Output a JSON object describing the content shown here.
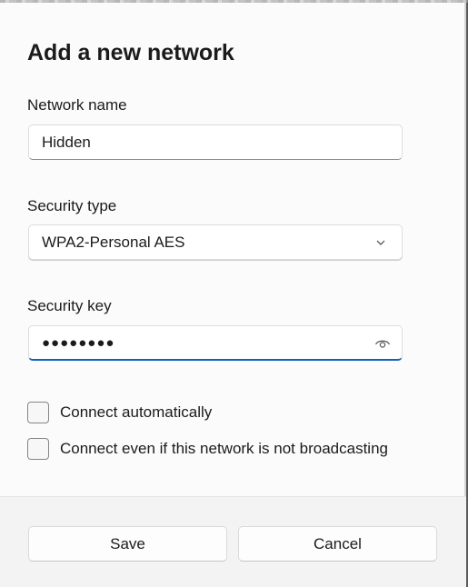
{
  "dialog": {
    "title": "Add a new network",
    "network_name": {
      "label": "Network name",
      "value": "Hidden"
    },
    "security_type": {
      "label": "Security type",
      "value": "WPA2-Personal AES",
      "icon": "chevron-down-icon"
    },
    "security_key": {
      "label": "Security key",
      "value": "●●●●●●●●",
      "icon": "reveal-password-eye-icon"
    },
    "options": [
      {
        "label": "Connect automatically",
        "checked": false
      },
      {
        "label": "Connect even if this network is not broadcasting",
        "checked": false
      }
    ],
    "buttons": {
      "save": "Save",
      "cancel": "Cancel"
    }
  },
  "colors": {
    "accent": "#0f62b9",
    "dialog_bg": "#fbfbfb",
    "footer_bg": "#f3f3f3"
  }
}
